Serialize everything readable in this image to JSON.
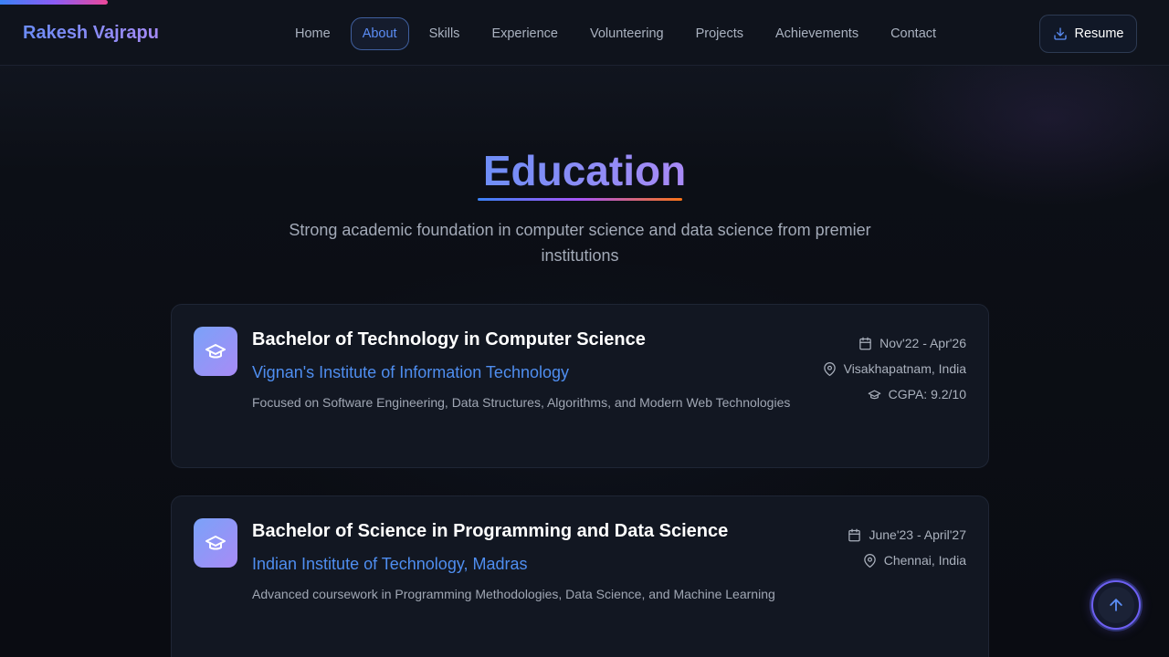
{
  "nav": {
    "logo": "Rakesh Vajrapu",
    "links": [
      {
        "label": "Home",
        "active": false
      },
      {
        "label": "About",
        "active": true
      },
      {
        "label": "Skills",
        "active": false
      },
      {
        "label": "Experience",
        "active": false
      },
      {
        "label": "Volunteering",
        "active": false
      },
      {
        "label": "Projects",
        "active": false
      },
      {
        "label": "Achievements",
        "active": false
      },
      {
        "label": "Contact",
        "active": false
      }
    ],
    "resume_label": "Resume",
    "resume_icon": "download-icon"
  },
  "section": {
    "title": "Education",
    "subtitle": "Strong academic foundation in computer science and data science from premier institutions"
  },
  "education": [
    {
      "degree": "Bachelor of Technology in Computer Science",
      "institute": "Vignan's Institute of Information Technology",
      "description": "Focused on Software Engineering, Data Structures, Algorithms, and Modern Web Technologies",
      "dates": "Nov'22 - Apr'26",
      "location": "Visakhapatnam, India",
      "gpa": "CGPA: 9.2/10"
    },
    {
      "degree": "Bachelor of Science in Programming and Data Science",
      "institute": "Indian Institute of Technology, Madras",
      "description": "Advanced coursework in Programming Methodologies, Data Science, and Machine Learning",
      "dates": "June'23 - April'27",
      "location": "Chennai, India"
    }
  ],
  "colors": {
    "accent": "#4f8ef0",
    "gradient_start": "#6e8ef7",
    "gradient_end": "#a98af6",
    "background": "#0b0d13",
    "card": "#121722"
  },
  "scroll_top_icon": "arrow-up-icon"
}
